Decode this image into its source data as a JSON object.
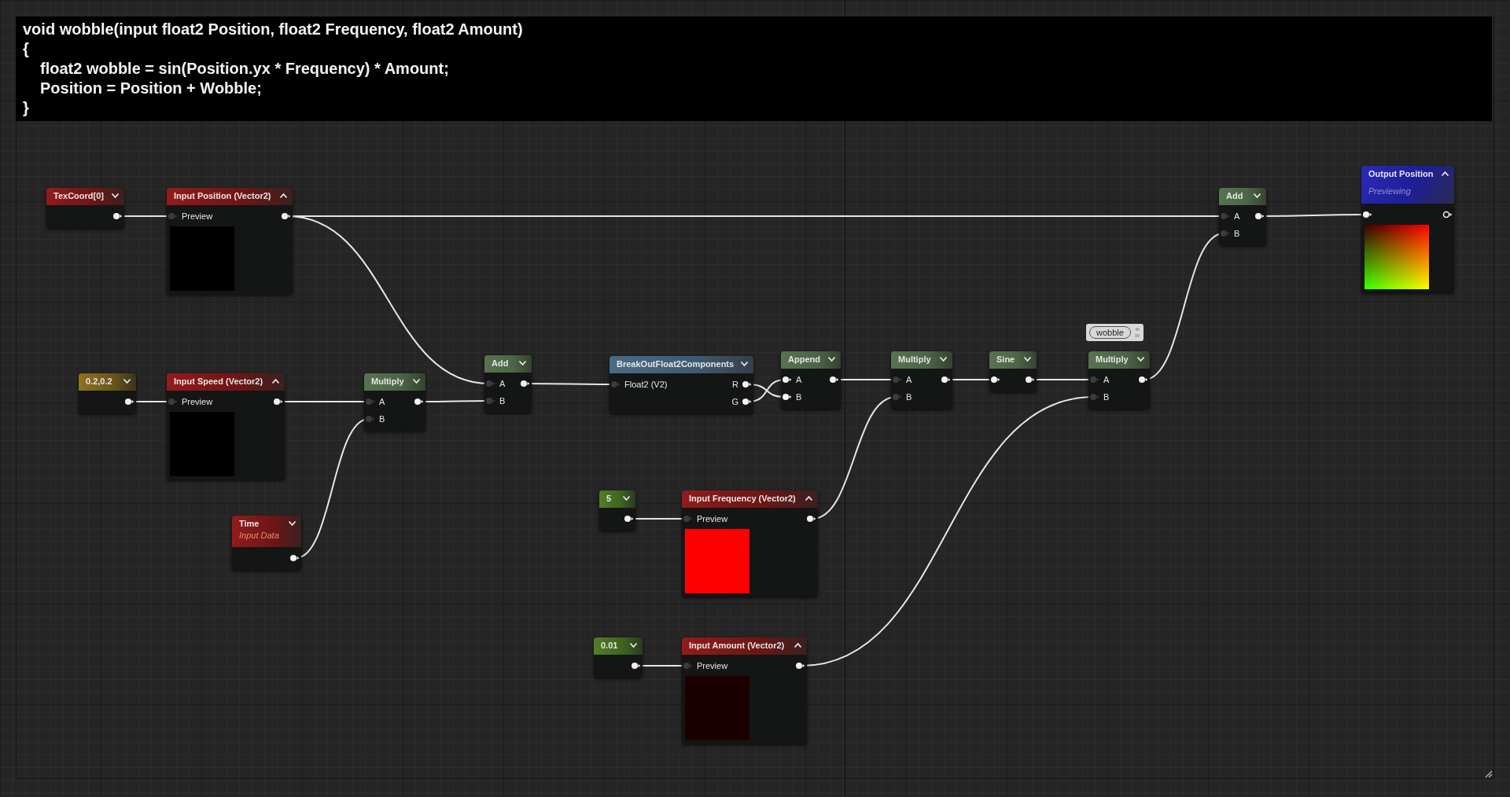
{
  "comment": {
    "lines": [
      {
        "text": "void wobble(input float2 Position, float2 Frequency, float2 Amount)"
      },
      {
        "text": "{",
        "children": [
          {
            "text": "float2 wobble = sin(Position.yx * Frequency) * Amount;"
          },
          {
            "text": "Position = Position + Wobble;"
          }
        ]
      },
      {
        "text": "}"
      }
    ]
  },
  "nodes": [
    {
      "kind": "coordinate",
      "title": "TexCoord[0]",
      "expanded": false,
      "outputs": [
        {
          "connected": true
        }
      ]
    },
    {
      "kind": "parameter",
      "title": "Input Position (Vector2)",
      "expanded": true,
      "preview": {
        "kind": "black"
      },
      "inputs": [
        {
          "label": "Preview",
          "connected": false
        }
      ],
      "outputs": [
        {
          "connected": true
        }
      ]
    },
    {
      "kind": "math",
      "title": "Add",
      "expanded": false,
      "inputs": [
        {
          "label": "A",
          "connected": false
        },
        {
          "label": "B",
          "connected": false
        }
      ],
      "outputs": [
        {
          "connected": true
        }
      ]
    },
    {
      "kind": "output",
      "title": "Output Position",
      "subtitle": "Previewing",
      "expanded": true,
      "preview": {
        "kind": "gradient"
      },
      "inputs": [
        {
          "connected": true
        }
      ],
      "outputs": [
        {
          "connected": false
        }
      ]
    },
    {
      "kind": "vector",
      "title": "0.2,0.2",
      "expanded": false,
      "outputs": [
        {
          "connected": true
        }
      ]
    },
    {
      "kind": "parameter",
      "title": "Input Speed (Vector2)",
      "expanded": true,
      "preview": {
        "kind": "black"
      },
      "inputs": [
        {
          "label": "Preview",
          "connected": false
        }
      ],
      "outputs": [
        {
          "connected": true
        }
      ]
    },
    {
      "kind": "math",
      "title": "Multiply",
      "expanded": false,
      "inputs": [
        {
          "label": "A",
          "connected": false
        },
        {
          "label": "B",
          "connected": false
        }
      ],
      "outputs": [
        {
          "connected": true
        }
      ]
    },
    {
      "kind": "math",
      "title": "Add",
      "expanded": false,
      "inputs": [
        {
          "label": "A",
          "connected": false
        },
        {
          "label": "B",
          "connected": false
        }
      ],
      "outputs": [
        {
          "connected": true
        }
      ]
    },
    {
      "kind": "utility",
      "title": "BreakOutFloat2Components",
      "expanded": false,
      "inputs": [
        {
          "label": "Float2 (V2)",
          "connected": false
        }
      ],
      "outputs": [
        {
          "label": "R",
          "connected": true
        },
        {
          "label": "G",
          "connected": true
        }
      ]
    },
    {
      "kind": "math",
      "title": "Append",
      "expanded": false,
      "inputs": [
        {
          "label": "A",
          "connected": true
        },
        {
          "label": "B",
          "connected": true
        }
      ],
      "outputs": [
        {
          "connected": true
        }
      ]
    },
    {
      "kind": "math",
      "title": "Multiply",
      "expanded": false,
      "inputs": [
        {
          "label": "A",
          "connected": false
        },
        {
          "label": "B",
          "connected": false
        }
      ],
      "outputs": [
        {
          "connected": true
        }
      ]
    },
    {
      "kind": "math",
      "title": "Sine",
      "expanded": false,
      "inputs": [
        {
          "connected": true
        }
      ],
      "outputs": [
        {
          "connected": true
        }
      ]
    },
    {
      "kind": "math",
      "title": "Multiply",
      "comment": "wobble",
      "expanded": false,
      "inputs": [
        {
          "label": "A",
          "connected": false
        },
        {
          "label": "B",
          "connected": false
        }
      ],
      "outputs": [
        {
          "connected": true
        }
      ]
    },
    {
      "kind": "time",
      "title": "Time",
      "subtitle": "Input Data",
      "expanded": false,
      "outputs": [
        {
          "connected": true
        }
      ]
    },
    {
      "kind": "scalar",
      "title": "5",
      "expanded": false,
      "outputs": [
        {
          "connected": true
        }
      ]
    },
    {
      "kind": "parameter",
      "title": "Input Frequency (Vector2)",
      "expanded": true,
      "preview": {
        "kind": "red"
      },
      "inputs": [
        {
          "label": "Preview",
          "connected": false
        }
      ],
      "outputs": [
        {
          "connected": true
        }
      ]
    },
    {
      "kind": "scalar",
      "title": "0.01",
      "expanded": false,
      "outputs": [
        {
          "connected": true
        }
      ]
    },
    {
      "kind": "parameter",
      "title": "Input Amount (Vector2)",
      "expanded": true,
      "preview": {
        "kind": "dark_red"
      },
      "inputs": [
        {
          "label": "Preview",
          "connected": false
        }
      ],
      "outputs": [
        {
          "connected": true
        }
      ]
    }
  ]
}
